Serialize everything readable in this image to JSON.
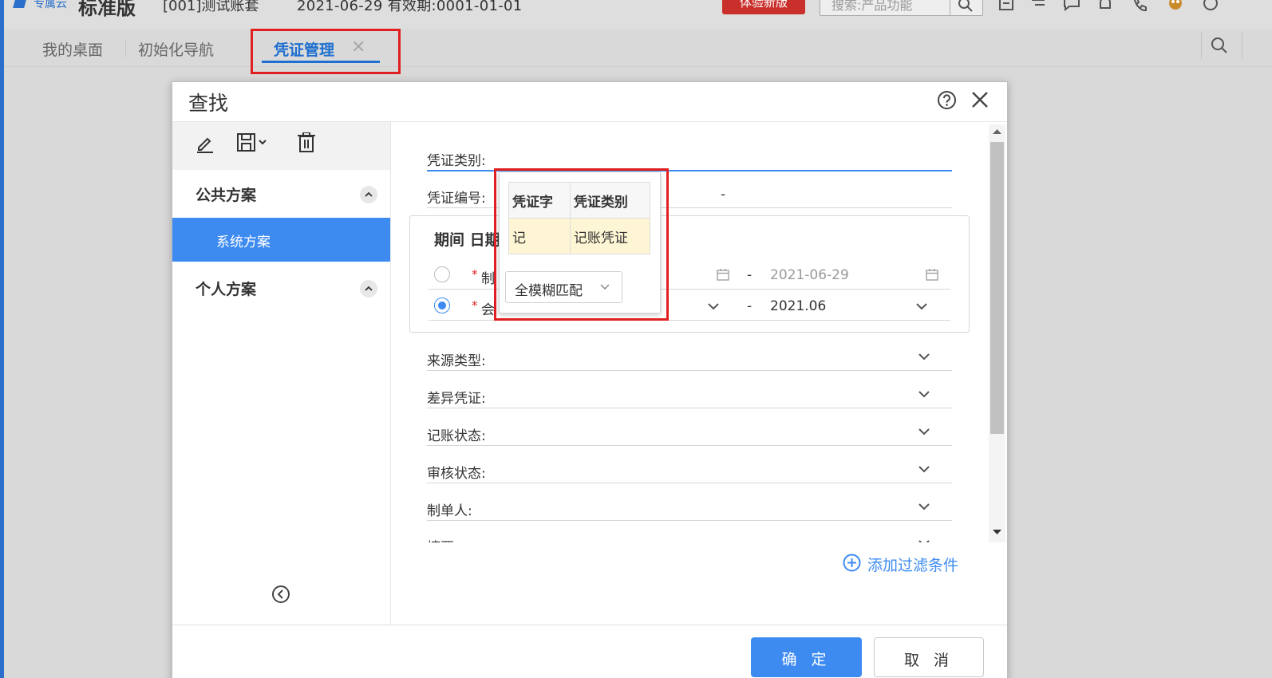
{
  "app": {
    "logo_sub": "专属云",
    "logo_title": "标准版",
    "account_name": "[001]测试账套",
    "account_dates": "2021-06-29  有效期:0001-01-01",
    "new_version_button": "体验新版",
    "search_placeholder": "搜索:产品功能"
  },
  "tabs": [
    {
      "label": "我的桌面"
    },
    {
      "label": "初始化导航"
    },
    {
      "label": "凭证管理",
      "active": true
    }
  ],
  "dialog": {
    "title": "查找",
    "sidebar": {
      "public_group": "公共方案",
      "system_scheme": "系统方案",
      "personal_group": "个人方案"
    },
    "fields": {
      "voucher_category": "凭证类别:",
      "voucher_number": "凭证编号:",
      "voucher_number_dash": "-",
      "period_title": "期间 日期",
      "period_row1_label": "制",
      "period_row1_to": "2021-06-29",
      "period_row2_label": "会",
      "period_row2_to": "2021.06",
      "range_dash": "-",
      "source_type": "来源类型:",
      "diff_voucher": "差异凭证:",
      "posting_status": "记账状态:",
      "audit_status": "审核状态:",
      "maker": "制单人:",
      "summary": "摘要:"
    },
    "add_filter": "添加过滤条件",
    "ok_button": "确 定",
    "cancel_button": "取 消"
  },
  "popup": {
    "columns": [
      "凭证字",
      "凭证类别"
    ],
    "rows": [
      [
        "记",
        "记账凭证"
      ]
    ],
    "match_mode": "全模糊匹配"
  },
  "colors": {
    "accent": "#3d8bf1",
    "highlight_box": "#e02020",
    "new_version": "#c9302c"
  }
}
